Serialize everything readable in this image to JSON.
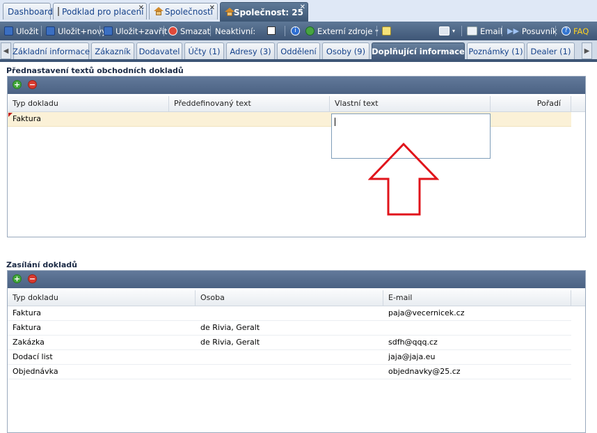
{
  "tabs": [
    {
      "label": "Dashboard",
      "icon": "none"
    },
    {
      "label": "Podklad pro placení",
      "icon": "document-icon",
      "closable": true
    },
    {
      "label": "Společnosti",
      "icon": "home-icon",
      "closable": true
    },
    {
      "label": "Společnost: 25",
      "icon": "home-icon",
      "closable": true,
      "active": true
    }
  ],
  "toolbar": {
    "save": "Uložit",
    "save_new": "Uložit+nový",
    "save_close": "Uložit+zavřít",
    "delete": "Smazat",
    "inactive_label": "Neaktivní:",
    "external": "Externí zdroje",
    "email": "Email",
    "posuvnik": "Posuvník",
    "faq": "FAQ"
  },
  "subtabs": [
    "Základní informace",
    "Zákazník",
    "Dodavatel",
    "Účty (1)",
    "Adresy (3)",
    "Oddělení",
    "Osoby (9)",
    "Doplňující informace",
    "Poznámky (1)",
    "Dealer (1)"
  ],
  "active_subtab": "Doplňující informace",
  "section1": {
    "title": "Přednastavení textů obchodních dokladů",
    "columns": [
      "Typ dokladu",
      "Předdefinovaný text",
      "Vlastní text",
      "Pořadí"
    ],
    "rows": [
      {
        "typ": "Faktura",
        "predef": "",
        "vlastni": "",
        "poradi": ""
      }
    ]
  },
  "section2": {
    "title": "Zasílání dokladů",
    "columns": [
      "Typ dokladu",
      "Osoba",
      "E-mail"
    ],
    "rows": [
      {
        "typ": "Faktura",
        "osoba": "",
        "email": "paja@vecernicek.cz"
      },
      {
        "typ": "Faktura",
        "osoba": "de Rivia, Geralt",
        "email": ""
      },
      {
        "typ": "Zakázka",
        "osoba": "de Rivia, Geralt",
        "email": "sdfh@qqq.cz"
      },
      {
        "typ": "Dodací list",
        "osoba": "",
        "email": "jaja@jaja.eu"
      },
      {
        "typ": "Objednávka",
        "osoba": "",
        "email": "objednavky@25.cz"
      }
    ]
  },
  "colors": {
    "accent": "#3e5676",
    "arrow": "#e0141b",
    "selected_row": "#fbf1d7"
  }
}
